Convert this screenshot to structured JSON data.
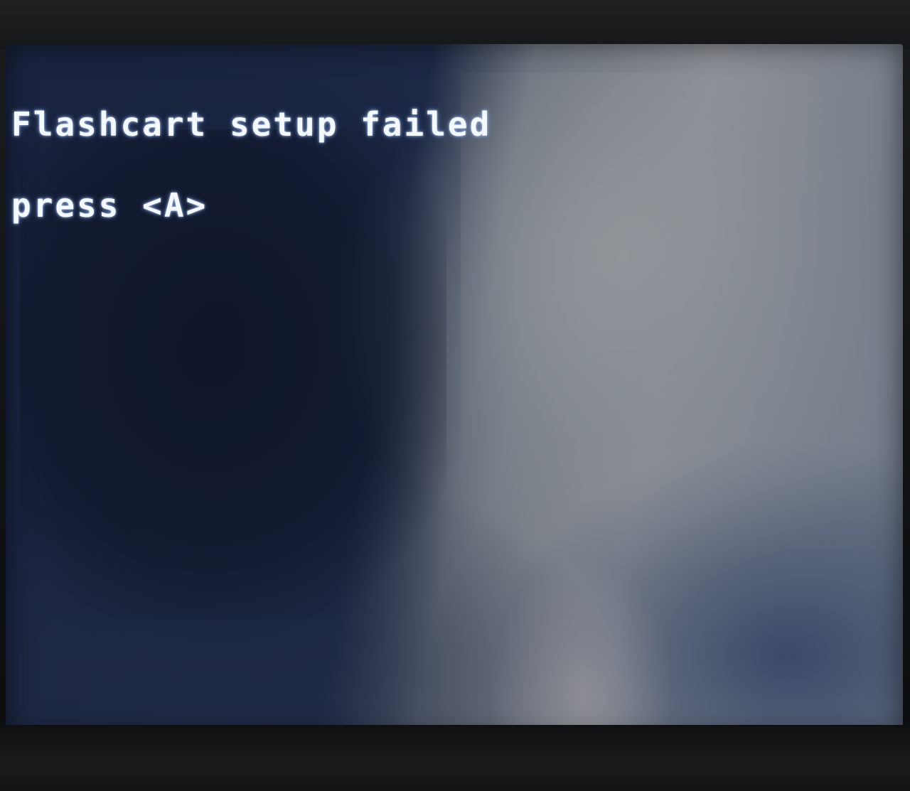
{
  "screen": {
    "lines": [
      "Flashcart setup failed",
      "press <A>"
    ]
  }
}
